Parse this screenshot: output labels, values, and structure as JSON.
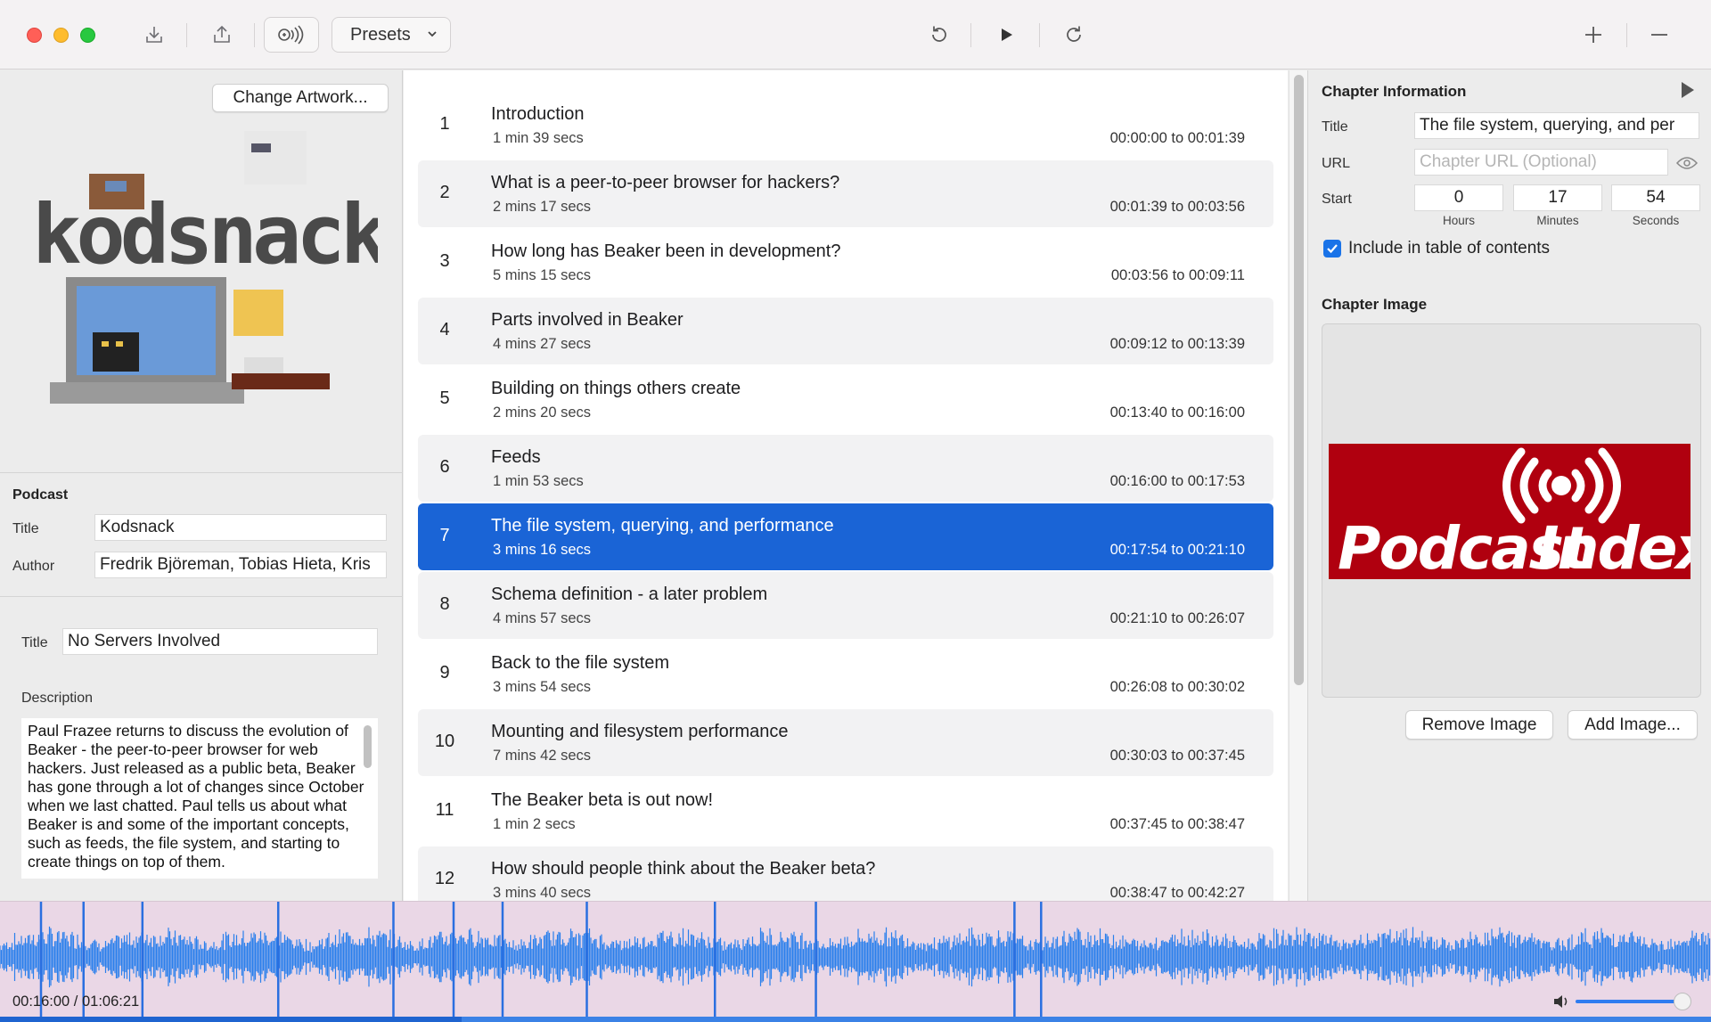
{
  "toolbar": {
    "presets_label": "Presets"
  },
  "podcast": {
    "change_artwork": "Change Artwork...",
    "section_label": "Podcast",
    "title_label": "Title",
    "title_value": "Kodsnack",
    "author_label": "Author",
    "author_value": "Fredrik Björeman, Tobias Hieta, Kris",
    "artwork_text": "kodsnack"
  },
  "episode": {
    "title_label": "Title",
    "title_value": "No Servers Involved",
    "description_label": "Description",
    "description": "Paul Frazee returns to discuss the evolution of Beaker - the peer-to-peer browser for web hackers. Just released as a public beta, Beaker has gone through a lot of changes since October when we last chatted. Paul tells us about what Beaker is and some of the important concepts, such as feeds, the file system, and starting to create things on top of them."
  },
  "chapters": [
    {
      "num": "1",
      "title": "Introduction",
      "duration": "1 min 39 secs",
      "range": "00:00:00 to 00:01:39"
    },
    {
      "num": "2",
      "title": "What is a peer-to-peer browser for hackers?",
      "duration": "2 mins 17 secs",
      "range": "00:01:39 to 00:03:56"
    },
    {
      "num": "3",
      "title": "How long has Beaker been in development?",
      "duration": "5 mins 15 secs",
      "range": "00:03:56 to 00:09:11"
    },
    {
      "num": "4",
      "title": "Parts involved in Beaker",
      "duration": "4 mins 27 secs",
      "range": "00:09:12 to 00:13:39"
    },
    {
      "num": "5",
      "title": "Building on things others create",
      "duration": "2 mins 20 secs",
      "range": "00:13:40 to 00:16:00"
    },
    {
      "num": "6",
      "title": "Feeds",
      "duration": "1 min 53 secs",
      "range": "00:16:00 to 00:17:53"
    },
    {
      "num": "7",
      "title": "The file system, querying, and performance",
      "duration": "3 mins 16 secs",
      "range": "00:17:54 to 00:21:10"
    },
    {
      "num": "8",
      "title": "Schema definition - a later problem",
      "duration": "4 mins 57 secs",
      "range": "00:21:10 to 00:26:07"
    },
    {
      "num": "9",
      "title": "Back to the file system",
      "duration": "3 mins 54 secs",
      "range": "00:26:08 to 00:30:02"
    },
    {
      "num": "10",
      "title": "Mounting and filesystem performance",
      "duration": "7 mins 42 secs",
      "range": "00:30:03 to 00:37:45"
    },
    {
      "num": "11",
      "title": "The Beaker beta is out now!",
      "duration": "1 min 2 secs",
      "range": "00:37:45 to 00:38:47"
    },
    {
      "num": "12",
      "title": "How should people think about the Beaker beta?",
      "duration": "3 mins 40 secs",
      "range": "00:38:47 to 00:42:27"
    }
  ],
  "selected_chapter": 7,
  "chapter_info": {
    "section_label": "Chapter Information",
    "title_label": "Title",
    "title_value": "The file system, querying, and per",
    "url_label": "URL",
    "url_placeholder": "Chapter URL (Optional)",
    "start_label": "Start",
    "hours": "0",
    "minutes": "17",
    "seconds": "54",
    "hours_caption": "Hours",
    "minutes_caption": "Minutes",
    "seconds_caption": "Seconds",
    "include_toc_label": "Include in table of contents",
    "include_toc_checked": true,
    "image_label": "Chapter Image",
    "image_logo_text_1": "Podcast",
    "image_logo_text_2": "Index",
    "remove_image": "Remove Image",
    "add_image": "Add Image..."
  },
  "player": {
    "time_display": "00:16:00 / 01:06:21",
    "played_fraction": 0.27,
    "volume_fraction": 0.95
  },
  "colors": {
    "accent": "#1a64d6",
    "waveform": "#2a7fec",
    "waveform_bg": "#ead7e6",
    "podcast_index_red": "#b0000f"
  }
}
